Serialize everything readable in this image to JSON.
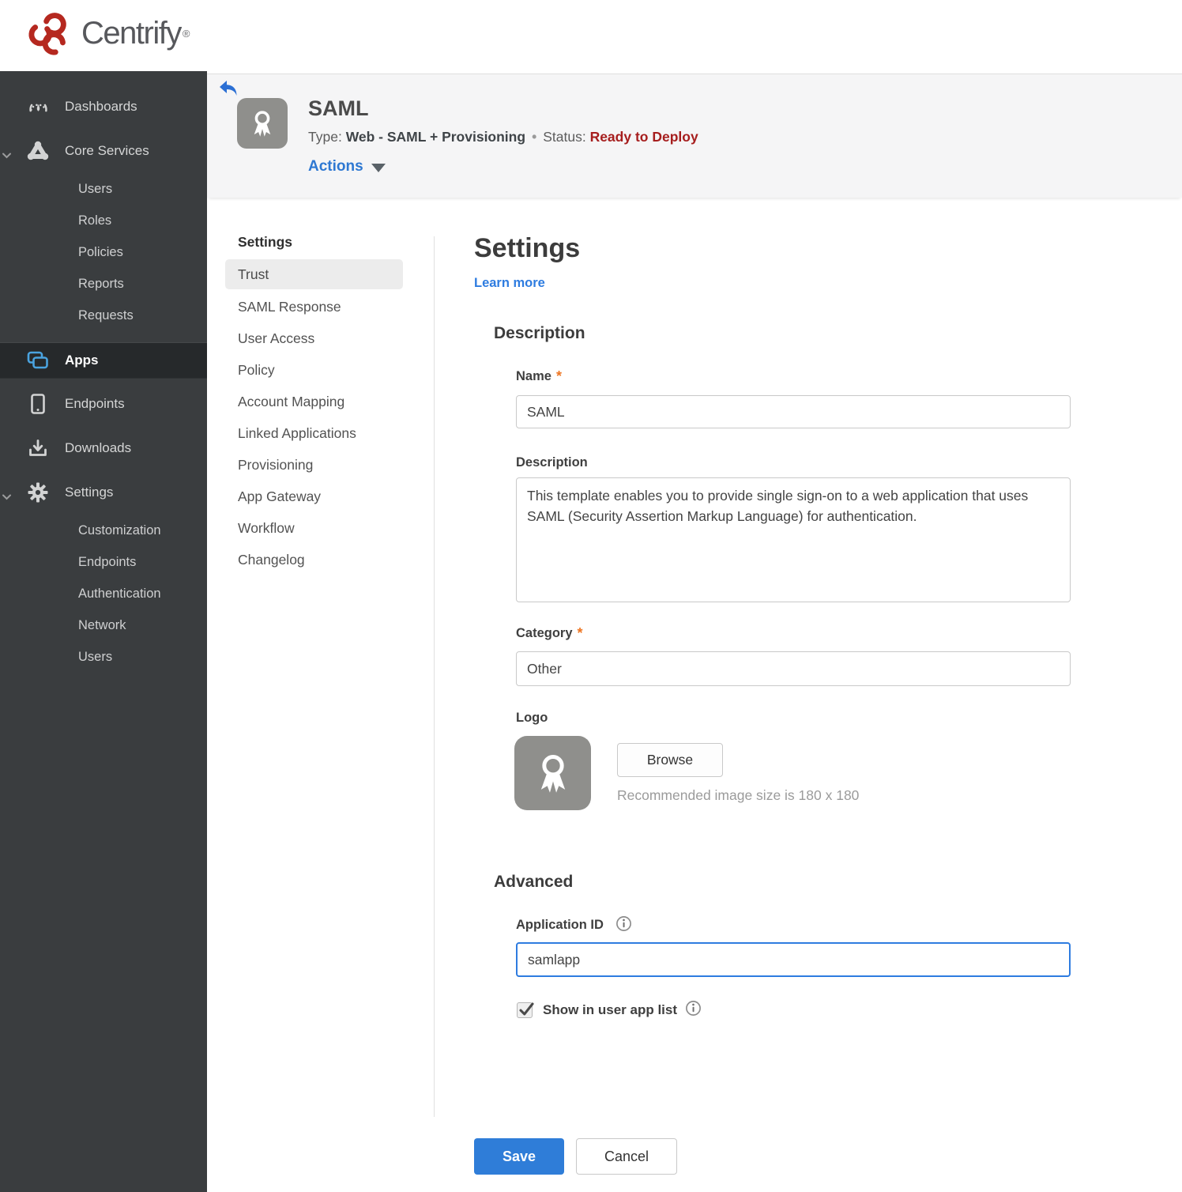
{
  "brand": {
    "name": "Centrify",
    "trademark": "®"
  },
  "sidebar": {
    "items": [
      {
        "label": "Dashboards"
      },
      {
        "label": "Core Services"
      },
      {
        "label": "Users"
      },
      {
        "label": "Roles"
      },
      {
        "label": "Policies"
      },
      {
        "label": "Reports"
      },
      {
        "label": "Requests"
      },
      {
        "label": "Apps"
      },
      {
        "label": "Endpoints"
      },
      {
        "label": "Downloads"
      },
      {
        "label": "Settings"
      },
      {
        "label": "Customization"
      },
      {
        "label": "Endpoints"
      },
      {
        "label": "Authentication"
      },
      {
        "label": "Network"
      },
      {
        "label": "Users"
      }
    ],
    "active_item": "Apps"
  },
  "header": {
    "title": "SAML",
    "type_label": "Type:",
    "type_value": "Web - SAML + Provisioning",
    "separator": "•",
    "status_label": "Status:",
    "status_value": "Ready to Deploy",
    "actions_label": "Actions"
  },
  "subnav": {
    "heading": "Settings",
    "selected": "Trust",
    "items": [
      "SAML Response",
      "User Access",
      "Policy",
      "Account Mapping",
      "Linked Applications",
      "Provisioning",
      "App Gateway",
      "Workflow",
      "Changelog"
    ]
  },
  "main": {
    "title": "Settings",
    "learn_more": "Learn more",
    "description": {
      "heading": "Description",
      "name_label": "Name",
      "name_value": "SAML",
      "description_label": "Description",
      "description_value": "This template enables you to provide single sign-on to a web application that uses SAML (Security Assertion Markup Language) for authentication.",
      "category_label": "Category",
      "category_value": "Other",
      "logo_label": "Logo",
      "browse_label": "Browse",
      "logo_hint": "Recommended image size is 180 x 180"
    },
    "advanced": {
      "heading": "Advanced",
      "app_id_label": "Application ID",
      "app_id_value": "samlapp",
      "show_in_user_app_list_label": "Show in user app list",
      "checkbox_checked": true
    },
    "footer": {
      "save_label": "Save",
      "cancel_label": "Cancel"
    }
  },
  "colors": {
    "brand_red": "#b5281f",
    "accent_blue": "#2f7dd8",
    "link_blue": "#2e7ce0",
    "status_red": "#a61e1e",
    "required_orange": "#ee7623",
    "sidebar_bg": "#3a3d3f",
    "sidebar_active_bg": "#26292b",
    "apps_icon_blue": "#4aa3df",
    "header_bg": "#f5f5f6"
  }
}
